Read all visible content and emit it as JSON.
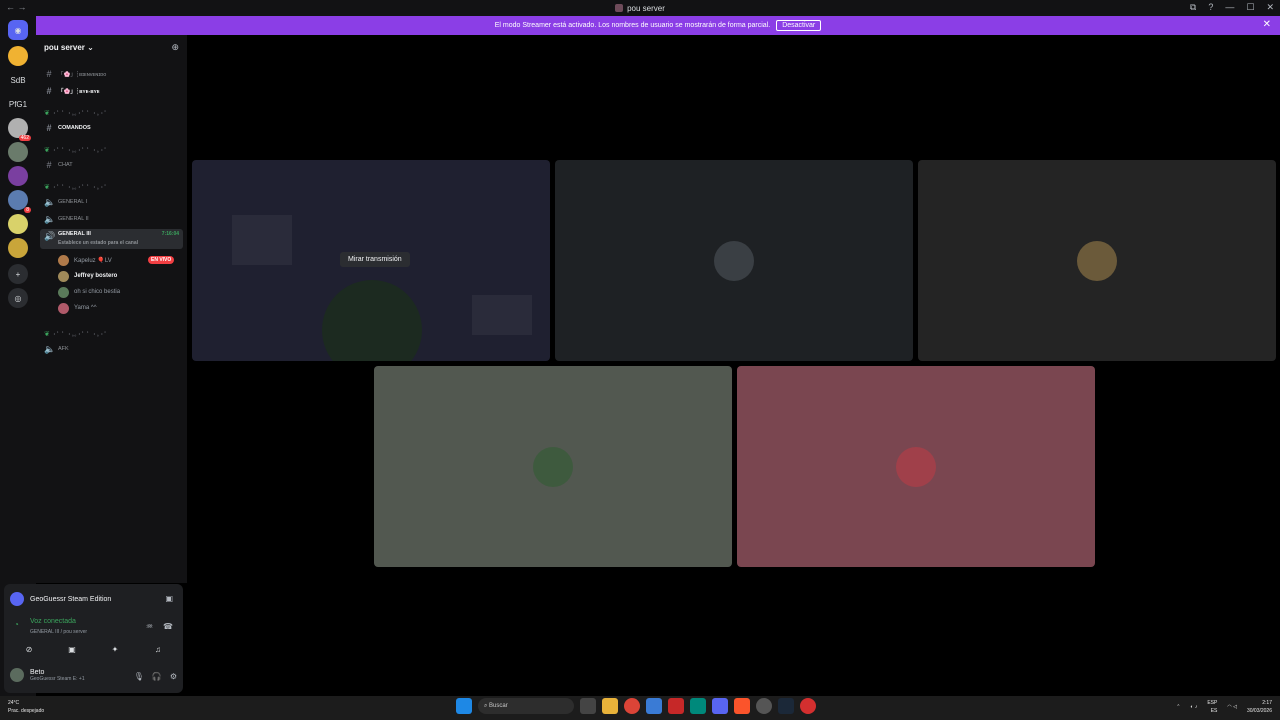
{
  "window": {
    "title": "pou server",
    "controls": [
      "⧉",
      "?",
      "—",
      "☐",
      "✕"
    ]
  },
  "banner": {
    "text": "El modo Streamer está activado. Los nombres de usuario se mostrarán de forma parcial.",
    "button": "Desactivar"
  },
  "guilds": [
    {
      "label": "",
      "badge": "",
      "color": "#f0b232"
    },
    {
      "label": "SdB",
      "badge": "",
      "color": ""
    },
    {
      "label": "PfG1",
      "badge": "",
      "color": ""
    },
    {
      "label": "",
      "badge": "462",
      "color": "#b0b0b0"
    },
    {
      "label": "",
      "badge": "",
      "color": "#6a7b6b"
    },
    {
      "label": "",
      "badge": "",
      "color": "#7a3fa0"
    },
    {
      "label": "",
      "badge": "8",
      "color": "#5b7cb0"
    },
    {
      "label": "",
      "badge": "",
      "color": "#d9d26a"
    },
    {
      "label": "",
      "badge": "",
      "color": "#c9a53a"
    }
  ],
  "server": {
    "name": "pou server ⌄"
  },
  "channels": {
    "bienvenido": "「🌸」┊ʙɪᴇɴᴠᴇɴɪᴅᴏ",
    "byebye": "「🌸」┊ʙʏᴇ-ʙʏᴇ",
    "cat1": "・゜゜・。。・゜゜・。・゜",
    "comandos": "COMANDOS",
    "cat2": "・゜゜・。。・゜゜・。・゜",
    "chat": "CHAT",
    "cat3": "・゜゜・。。・゜゜・。・゜",
    "general1": "GENERAL I",
    "general2": "GENERAL II",
    "general3": "GENERAL III",
    "general3_timer": "7:16:04",
    "general3_status": "Establece un estado para el canal",
    "cat4": "・゜゜・。。・゜゜・。・゜",
    "afk": "AFK"
  },
  "members": [
    {
      "name": "Kapeluz 🎈LV",
      "live": "EN VIVO",
      "color": "#b07a4a"
    },
    {
      "name": "Jeffrey bostero",
      "live": "",
      "color": "#a08a5a"
    },
    {
      "name": "oh si chico bestia",
      "live": "",
      "color": "#5a7a5a"
    },
    {
      "name": "Yama ^^",
      "live": "",
      "color": "#b05a6a"
    }
  ],
  "panel": {
    "activity": "GeoGuessr Steam Edition",
    "voice": "Voz conectada",
    "voice_sub": "GENERAL III / pou server",
    "user": "Beto",
    "user_status": "GeoGuessr Steam E: +1"
  },
  "stage": {
    "watch_label": "Mirar transmisión"
  },
  "taskbar": {
    "temp": "24°C",
    "weather": "Prac. despejado",
    "search": "Buscar",
    "lang": "ESP",
    "lang2": "ES",
    "time": "2:17",
    "date": "30/03/2026"
  }
}
